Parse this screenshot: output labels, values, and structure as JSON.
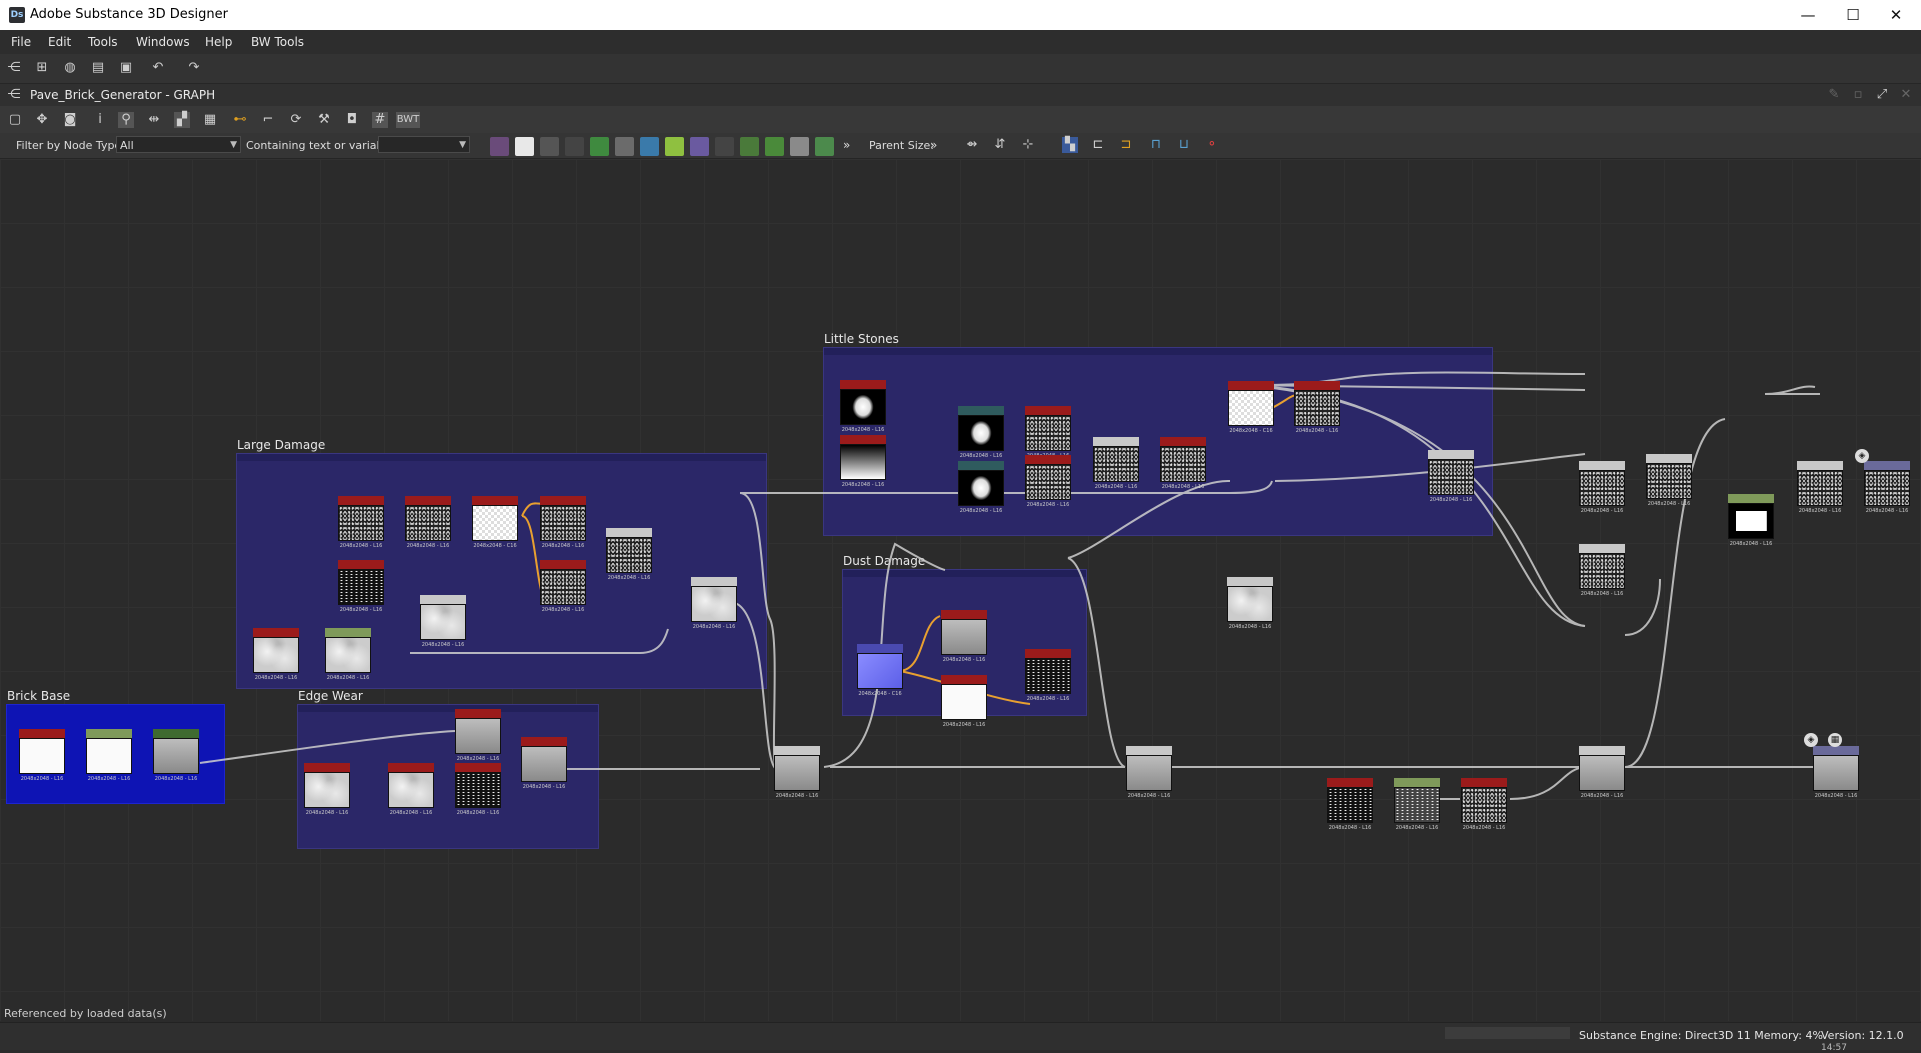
{
  "window": {
    "title": "Adobe Substance 3D Designer",
    "app_icon": "Ds",
    "minimize": "—",
    "maximize": "☐",
    "close": "✕"
  },
  "menu": [
    "File",
    "Edit",
    "Tools",
    "Windows",
    "Help",
    "BW Tools"
  ],
  "graph": {
    "title": "Pave_Brick_Generator - GRAPH",
    "bwt_label": "BWT"
  },
  "filter": {
    "label": "Filter by Node Type",
    "value": "All",
    "text_label": "Containing text or variable",
    "text_value": "",
    "parent_size_label": "Parent Size:",
    "more": "»"
  },
  "frames": {
    "large_damage": "Large Damage",
    "little_stones": "Little Stones",
    "dust_damage": "Dust Damage",
    "brick_base": "Brick Base",
    "edge_wear": "Edge Wear"
  },
  "node_size_label": "2048x2048 - L16",
  "node_size_label_c": "2048x2048 - C16",
  "status": {
    "left": "Referenced by loaded data(s)",
    "engine": "Substance Engine: Direct3D 11  Memory: 4%",
    "version": "Version: 12.1.0",
    "time": "14:57"
  },
  "colors": {
    "frame": "#2b2768",
    "brick_base_frame": "#0e14b4",
    "node_red": "#9b1b1b",
    "node_gray": "#c8c8c8",
    "node_green": "#7f9a5a",
    "node_teal": "#2f5b5e",
    "node_blue": "#4a4ab0"
  }
}
